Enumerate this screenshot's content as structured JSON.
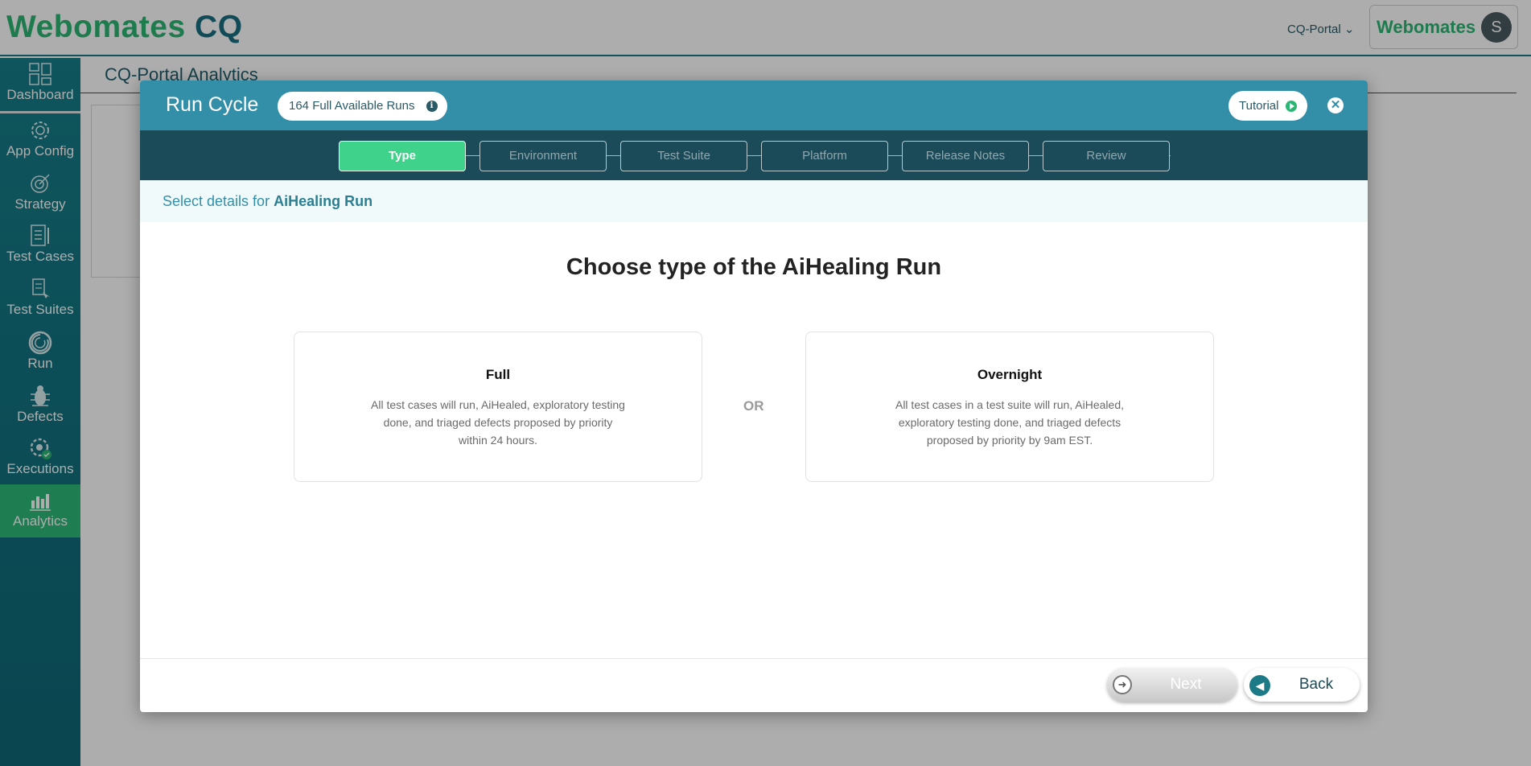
{
  "app": {
    "logo_part1": "Webomates",
    "logo_part2": " CQ",
    "portal_select": "CQ-Portal",
    "user_brand": "Webomates",
    "user_initial": "S"
  },
  "sidebar": {
    "items": [
      {
        "label": "Dashboard",
        "icon": "dashboard-icon"
      },
      {
        "label": "App Config",
        "icon": "gear-icon"
      },
      {
        "label": "Strategy",
        "icon": "target-icon"
      },
      {
        "label": "Test Cases",
        "icon": "document-icon"
      },
      {
        "label": "Test Suites",
        "icon": "suite-icon"
      },
      {
        "label": "Run",
        "icon": "spiral-icon"
      },
      {
        "label": "Defects",
        "icon": "bug-icon"
      },
      {
        "label": "Executions",
        "icon": "execution-gear-icon"
      },
      {
        "label": "Analytics",
        "icon": "bar-chart-icon"
      }
    ],
    "active_item": "Analytics"
  },
  "background_page": {
    "title": "CQ-Portal Analytics"
  },
  "modal": {
    "title": "Run Cycle",
    "runs_badge": "164 Full Available Runs",
    "tutorial_label": "Tutorial",
    "steps": [
      "Type",
      "Environment",
      "Test Suite",
      "Platform",
      "Release Notes",
      "Review"
    ],
    "active_step": "Type",
    "subheader_prefix": "Select details for ",
    "subheader_highlight": "AiHealing Run",
    "heading": "Choose type of the AiHealing Run",
    "or_label": "OR",
    "options": [
      {
        "title": "Full",
        "description": "All test cases will run, AiHealed, exploratory testing done, and triaged defects proposed by priority within 24 hours."
      },
      {
        "title": "Overnight",
        "description": "All test cases in a test suite will run, AiHealed, exploratory testing done, and triaged defects proposed by priority by 9am EST."
      }
    ],
    "next_label": "Next",
    "back_label": "Back"
  },
  "colors": {
    "header_teal": "#338fa8",
    "stepper_dark": "#1b4a58",
    "active_green": "#3ed28a",
    "sidebar_teal": "#167e89"
  }
}
